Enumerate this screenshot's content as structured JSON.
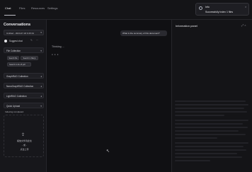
{
  "top_nav": {
    "tabs": [
      {
        "label": "Chat"
      },
      {
        "label": "Files"
      },
      {
        "label": "Resources"
      },
      {
        "label": "Settings"
      }
    ]
  },
  "toast": {
    "title": "Info",
    "message": "Successfully Index 1 files",
    "close": "×"
  },
  "sidebar": {
    "title": "Conversations",
    "conversation_select": "Untitled - 2024-07-18 9:45:01",
    "chat_item": "Suggest chat",
    "chat_actions": "✎ ⋯",
    "file_collection": {
      "label": "File Collection",
      "buttons": [
        "Search file",
        "Search in file(s)"
      ],
      "search_select": "Search in ALL 8 pdf"
    },
    "collections": [
      {
        "label": "GraphRAG Collection"
      },
      {
        "label": "NanoGraphRAG Collection"
      },
      {
        "label": "LightRAG Collection"
      }
    ],
    "quick_upload": {
      "label": "Quick Upload",
      "status": "Indexing completed.",
      "line1": "拖放文件到此处",
      "line2": "- 或 -",
      "line3": "点击上传"
    }
  },
  "chat": {
    "user_message": "What is the summary of this document?",
    "assistant_status": "Thinking ...",
    "typing": "● ● ●"
  },
  "info_panel": {
    "title": "Information panel",
    "icons": "⤢ ×"
  },
  "colors": {
    "background": "#0f0f12",
    "panel": "#17171b",
    "accent": "#2a2a30"
  }
}
